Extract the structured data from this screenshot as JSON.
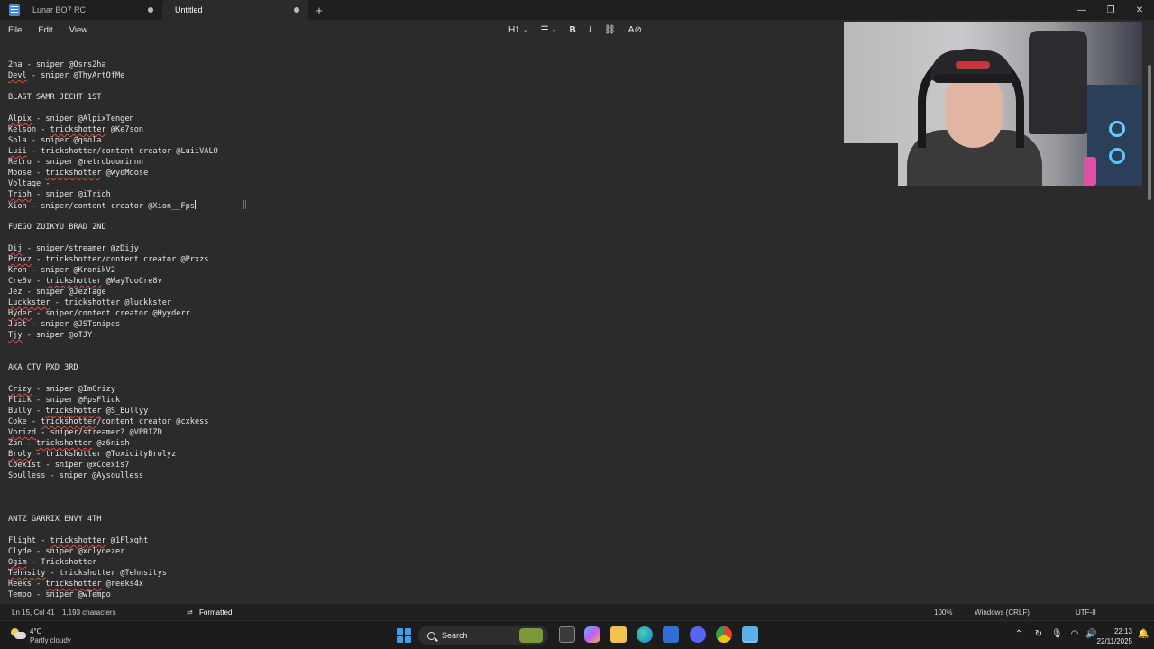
{
  "tabs": [
    {
      "title": "Lunar BO7 RC"
    },
    {
      "title": "Untitled"
    }
  ],
  "window_controls": {
    "minimize": "—",
    "restore": "❐",
    "close": "✕",
    "new_tab": "+"
  },
  "menu": [
    "File",
    "Edit",
    "View"
  ],
  "toolbar": {
    "heading": "H1",
    "list": "☰",
    "bold": "B",
    "italic": "I",
    "link": "⛓",
    "clear": "A⊘"
  },
  "document": [
    {
      "text": "2ha - sniper @Osrs2ha"
    },
    {
      "pre": "",
      "spell": "Devl",
      "post": " - sniper @ThyArtOfMe"
    },
    {
      "text": ""
    },
    {
      "text": "BLAST SAMR JECHT 1ST"
    },
    {
      "text": ""
    },
    {
      "pre": "",
      "spell": "Alpix",
      "post": " - sniper @AlpixTengen"
    },
    {
      "pre": "Kelson - ",
      "spell": "trickshotter",
      "post": " @Ke7son"
    },
    {
      "text": "Sola - sniper @qsola"
    },
    {
      "pre": "",
      "spell": "Luii",
      "post": " - trickshotter/content creator @LuiiVALO"
    },
    {
      "text": "Retro - sniper @retroboominnn"
    },
    {
      "pre": "Moose - ",
      "spell": "trickshotter",
      "post": " @wydMoose"
    },
    {
      "text": "Voltage -"
    },
    {
      "pre": "",
      "spell": "Trioh",
      "post": " - sniper @iTrioh"
    },
    {
      "text": "Xion - sniper/content creator @Xion__Fps",
      "caret": true
    },
    {
      "text": ""
    },
    {
      "text": "FUEGO ZUIKYU BRAD 2ND"
    },
    {
      "text": ""
    },
    {
      "pre": "",
      "spell": "Dij",
      "post": " - sniper/streamer @zDijy"
    },
    {
      "pre": "",
      "spell": "Proxz",
      "post": " - trickshotter/content creator @Prxzs"
    },
    {
      "text": "Kron - sniper @KronikV2"
    },
    {
      "pre": "Cre8v - ",
      "spell": "trickshotter",
      "post": " @WayTooCre8v"
    },
    {
      "text": "Jez - sniper @JezTage"
    },
    {
      "pre": "",
      "spell": "Luckkster",
      "post": " - trickshotter @luckkster"
    },
    {
      "pre": "",
      "spell": "Hyder",
      "post": " - sniper/content creator @Hyyderr"
    },
    {
      "text": "Just - sniper @JSTsnipes"
    },
    {
      "pre": "",
      "spell": "Tjy",
      "post": " - sniper @oTJY"
    },
    {
      "text": ""
    },
    {
      "text": ""
    },
    {
      "text": "AKA CTV PXD 3RD"
    },
    {
      "text": ""
    },
    {
      "pre": "",
      "spell": "Crizy",
      "post": " - sniper @ImCrizy"
    },
    {
      "text": "Flick - sniper @FpsFlick"
    },
    {
      "pre": "Bully - ",
      "spell": "trickshotter",
      "post": " @S_Bullyy"
    },
    {
      "pre": "Coke - ",
      "spell": "trickshotter",
      "post": "/content creator @cxkess"
    },
    {
      "pre": "",
      "spell": "Vprizd",
      "post": " - sniper/streamer? @VPRIZD"
    },
    {
      "pre": "Zan - ",
      "spell": "trickshotter",
      "post": " @z6nish"
    },
    {
      "pre": "",
      "spell": "Broly",
      "post": " - trickshotter @ToxicityBrolyz"
    },
    {
      "text": "Coexist - sniper @xCoexis7"
    },
    {
      "text": "Soulless - sniper @Aysoulless"
    },
    {
      "text": ""
    },
    {
      "text": ""
    },
    {
      "text": ""
    },
    {
      "text": "ANTZ GARRIX ENVY 4TH"
    },
    {
      "text": ""
    },
    {
      "pre": "Flight - ",
      "spell": "trickshotter",
      "post": " @1Flxght"
    },
    {
      "text": "Clyde - sniper @xclydezer"
    },
    {
      "pre": "",
      "spell": "Ogim",
      "post": " - Trickshotter"
    },
    {
      "pre": "",
      "spell": "Tehnsity",
      "post": " - trickshotter @Tehnsitys"
    },
    {
      "pre": "Reeks - ",
      "spell": "trickshotter",
      "post": " @reeks4x"
    },
    {
      "text": "Tempo - sniper @wTempo"
    }
  ],
  "status": {
    "position": "Ln 15, Col 41",
    "characters": "1,193 characters",
    "format_icon": "⇄",
    "format": "Formatted",
    "zoom": "100%",
    "line_ending": "Windows (CRLF)",
    "encoding": "UTF-8"
  },
  "taskbar": {
    "weather_temp": "4°C",
    "weather_desc": "Partly cloudy",
    "search_label": "Search",
    "apps": [
      "file-explorer-icon",
      "copilot-icon",
      "folder-icon",
      "edge-icon",
      "store-icon",
      "discord-icon",
      "chrome-icon",
      "notepad-icon"
    ],
    "time": "22:13",
    "date": "22/11/2025"
  },
  "colors": {
    "accent": "#3aa0f3",
    "spell_error": "#e04a4a",
    "editor_bg": "#2b2b2b"
  }
}
